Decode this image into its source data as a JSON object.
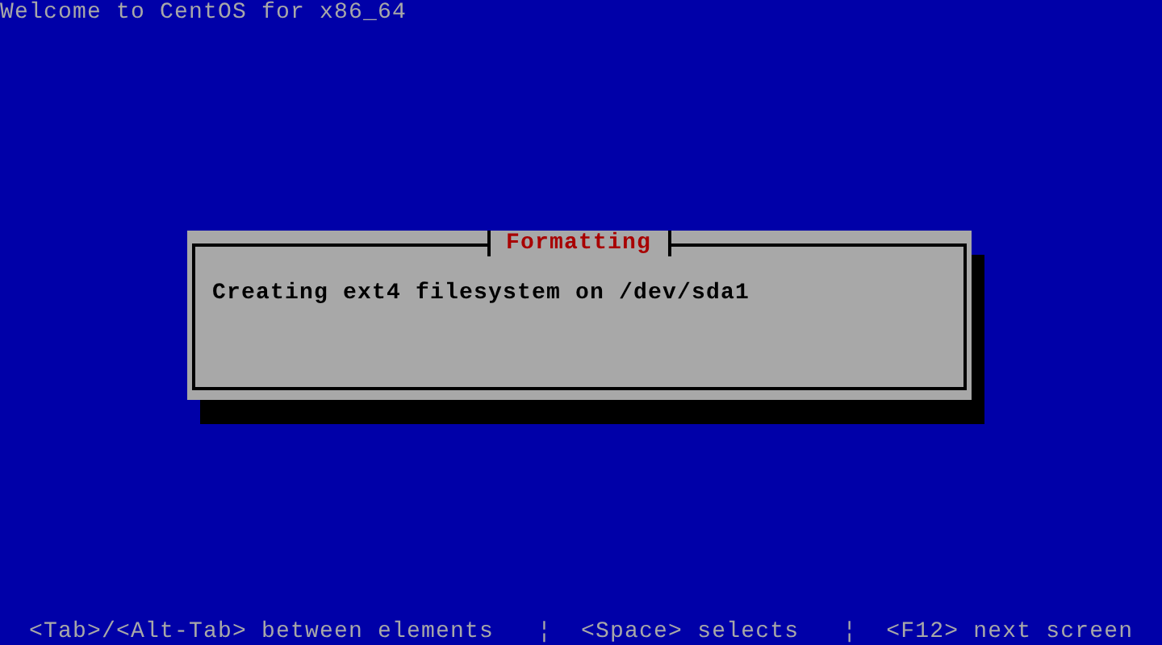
{
  "screen_title": "Welcome to CentOS for x86_64",
  "dialog": {
    "title": "Formatting",
    "message": "Creating ext4 filesystem on /dev/sda1"
  },
  "help_bar": "  <Tab>/<Alt-Tab> between elements   ¦  <Space> selects   ¦  <F12> next screen"
}
